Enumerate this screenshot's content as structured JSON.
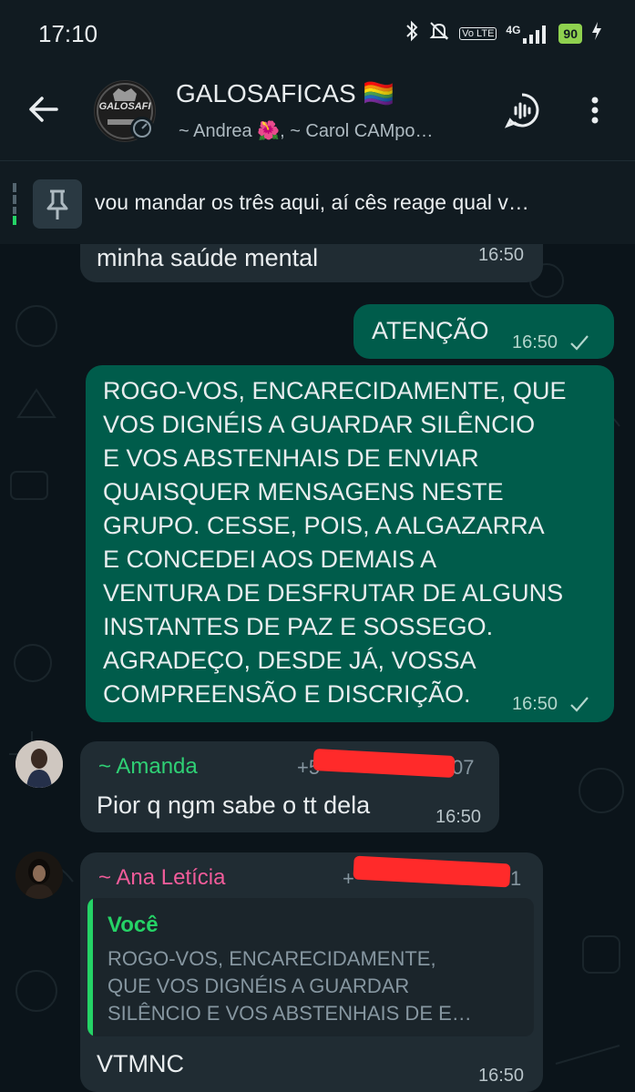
{
  "status_bar": {
    "time": "17:10",
    "volte": "Vo LTE",
    "network": "4G",
    "battery": "90"
  },
  "header": {
    "title": "GALOSAFICAS 🏳️‍🌈",
    "members": "~ Andrea 🌺, ~ Carol CAMpo…",
    "avatar_text": "GALOSAFI"
  },
  "pinned": {
    "text": "vou mandar os três aqui, aí cês reage qual v…"
  },
  "messages": {
    "m1": {
      "text": "minha saúde mental",
      "time": "16:50"
    },
    "m2": {
      "text": "ATENÇÃO",
      "time": "16:50"
    },
    "m3": {
      "text": "ROGO-VOS, ENCARECIDAMENTE, QUE\nVOS DIGNÉIS A GUARDAR SILÊNCIO\nE VOS ABSTENHAIS DE ENVIAR\nQUAISQUER MENSAGENS NESTE\nGRUPO. CESSE, POIS, A ALGAZARRA\nE CONCEDEI AOS DEMAIS A\nVENTURA DE DESFRUTAR DE ALGUNS\nINSTANTES DE PAZ E SOSSEGO.\nAGRADEÇO, DESDE JÁ, VOSSA\nCOMPREENSÃO E DISCRIÇÃO.",
      "time": "16:50"
    },
    "m4": {
      "sender": "~ Amanda",
      "phone_prefix": "+5",
      "phone_suffix": "07",
      "text": "Pior q ngm sabe o tt dela",
      "time": "16:50"
    },
    "m5": {
      "sender": "~ Ana Letícia",
      "phone_prefix": "+",
      "phone_suffix": "1",
      "quote_author": "Você",
      "quote_text": "ROGO-VOS, ENCARECIDAMENTE,\nQUE VOS DIGNÉIS A GUARDAR\nSILÊNCIO E VOS ABSTENHAIS DE E…",
      "text": "VTMNC",
      "time": "16:50"
    }
  },
  "colors": {
    "amanda_name": "#2fd075",
    "ana_name": "#f15c9a",
    "quote_author": "#25d366",
    "outgoing_bubble": "#005c4b",
    "incoming_bubble": "#202c33",
    "tick": "#b3d6cd"
  }
}
